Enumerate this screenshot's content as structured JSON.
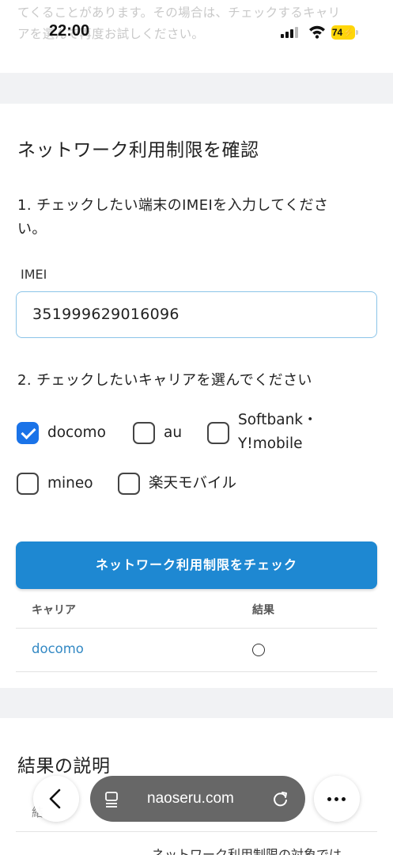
{
  "status_bar": {
    "time": "22:00",
    "battery": "74"
  },
  "notice_top": {
    "line1": "てくることがあります。その場合は、チェックするキャリ",
    "line2": "アを選んで再度お試しください。"
  },
  "form": {
    "title": "ネットワーク利用制限を確認",
    "step1_line1": "1. チェックしたい端末のIMEIを入力してくださ",
    "step1_line2": "い。",
    "imei_label": "IMEI",
    "imei_value": "351999629016096",
    "step2": "2. チェックしたいキャリアを選んでください",
    "carriers": [
      {
        "label": "docomo",
        "checked": true
      },
      {
        "label": "au",
        "checked": false
      },
      {
        "label_line1": "Softbank・",
        "label_line2": "Y!mobile",
        "checked": false
      },
      {
        "label": "mineo",
        "checked": false
      },
      {
        "label": "楽天モバイル",
        "checked": false
      }
    ],
    "submit_label": "ネットワーク利用制限をチェック"
  },
  "results_table": {
    "headers": [
      "キャリア",
      "結果"
    ],
    "rows": [
      {
        "carrier": "docomo",
        "result_icon": "circle-icon"
      }
    ]
  },
  "explanation": {
    "title": "結果の説明",
    "partial_cell": "結",
    "partial_text": "ネットワーク利用制限の対象では"
  },
  "browser_bar": {
    "url": "naoseru.com"
  },
  "colors": {
    "accent": "#1e88d2",
    "checkbox_checked": "#1a73e8",
    "link": "#3389c4",
    "section_band": "#f1f2f4",
    "battery": "#ffd60a"
  }
}
